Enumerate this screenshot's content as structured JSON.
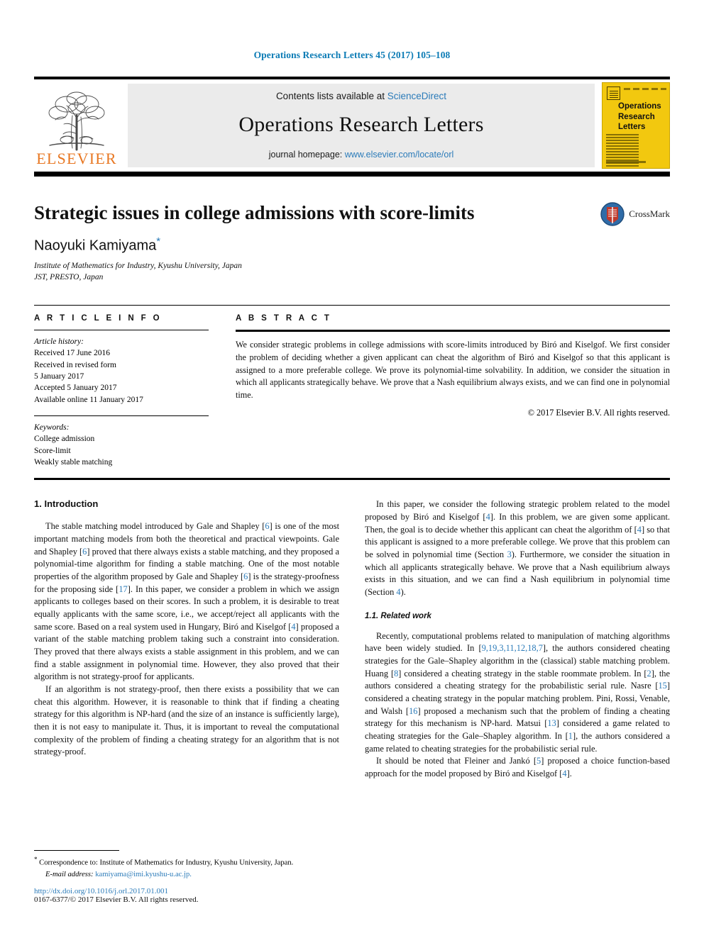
{
  "running_head": "Operations Research Letters 45 (2017) 105–108",
  "masthead": {
    "publisher_name": "ELSEVIER",
    "contents_prefix": "Contents lists available at ",
    "contents_link": "ScienceDirect",
    "journal_name": "Operations Research Letters",
    "homepage_prefix": "journal homepage: ",
    "homepage_url": "www.elsevier.com/locate/orl",
    "cover_title": "Operations Research Letters"
  },
  "article": {
    "title": "Strategic issues in college admissions with score-limits",
    "author": "Naoyuki Kamiyama",
    "author_marker": "*",
    "affiliation_1": "Institute of Mathematics for Industry, Kyushu University, Japan",
    "affiliation_2": "JST, PRESTO, Japan",
    "crossmark_label": "CrossMark"
  },
  "info": {
    "section_label": "A R T I C L E   I N F O",
    "history_heading": "Article history:",
    "history_lines": [
      "Received 17 June 2016",
      "Received in revised form",
      "5 January 2017",
      "Accepted 5 January 2017",
      "Available online 11 January 2017"
    ],
    "keywords_heading": "Keywords:",
    "keywords": [
      "College admission",
      "Score-limit",
      "Weakly stable matching"
    ]
  },
  "abstract": {
    "section_label": "A B S T R A C T",
    "text": "We consider strategic problems in college admissions with score-limits introduced by Biró and Kiselgof. We first consider the problem of deciding whether a given applicant can cheat the algorithm of Biró and Kiselgof so that this applicant is assigned to a more preferable college. We prove its polynomial-time solvability. In addition, we consider the situation in which all applicants strategically behave. We prove that a Nash equilibrium always exists, and we can find one in polynomial time.",
    "copyright": "© 2017 Elsevier B.V. All rights reserved."
  },
  "body": {
    "section_1_heading": "1.  Introduction",
    "left_paragraphs": [
      "The stable matching model introduced by Gale and Shapley [6] is one of the most important matching models from both the theoretical and practical viewpoints. Gale and Shapley [6] proved that there always exists a stable matching, and they proposed a polynomial-time algorithm for finding a stable matching. One of the most notable properties of the algorithm proposed by Gale and Shapley [6] is the strategy-proofness for the proposing side [17]. In this paper, we consider a problem in which we assign applicants to colleges based on their scores. In such a problem, it is desirable to treat equally applicants with the same score, i.e., we accept/reject all applicants with the same score. Based on a real system used in Hungary, Biró and Kiselgof [4] proposed a variant of the stable matching problem taking such a constraint into consideration. They proved that there always exists a stable assignment in this problem, and we can find a stable assignment in polynomial time. However, they also proved that their algorithm is not strategy-proof for applicants.",
      "If an algorithm is not strategy-proof, then there exists a possibility that we can cheat this algorithm. However, it is reasonable to think that if finding a cheating strategy for this algorithm is NP-hard (and the size of an instance is sufficiently large), then it is not easy to manipulate it. Thus, it is important to reveal the computational complexity of the problem of finding a cheating strategy for an algorithm that is not strategy-proof."
    ],
    "right_intro_paragraph": "In this paper, we consider the following strategic problem related to the model proposed by Biró and Kiselgof [4]. In this problem, we are given some applicant. Then, the goal is to decide whether this applicant can cheat the algorithm of [4] so that this applicant is assigned to a more preferable college. We prove that this problem can be solved in polynomial time (Section 3). Furthermore, we consider the situation in which all applicants strategically behave. We prove that a Nash equilibrium always exists in this situation, and we can find a Nash equilibrium in polynomial time (Section 4).",
    "subsection_1_1_heading": "1.1.  Related work",
    "right_paragraphs": [
      "Recently, computational problems related to manipulation of matching algorithms have been widely studied. In [9,19,3,11,12,18,7], the authors considered cheating strategies for the Gale–Shapley algorithm in the (classical) stable matching problem. Huang [8] considered a cheating strategy in the stable roommate problem. In [2], the authors considered a cheating strategy for the probabilistic serial rule. Nasre [15] considered a cheating strategy in the popular matching problem. Pini, Rossi, Venable, and Walsh [16] proposed a mechanism such that the problem of finding a cheating strategy for this mechanism is NP-hard. Matsui [13] considered a game related to cheating strategies for the Gale–Shapley algorithm. In [1], the authors considered a game related to cheating strategies for the probabilistic serial rule.",
      "It should be noted that Fleiner and Jankó [5] proposed a choice function-based approach for the model proposed by Biró and Kiselgof [4]."
    ]
  },
  "footnote": {
    "marker": "*",
    "correspondence": "Correspondence to: Institute of Mathematics for Industry, Kyushu University, Japan.",
    "email_label": "E-mail address:",
    "email": "kamiyama@imi.kyushu-u.ac.jp.",
    "doi": "http://dx.doi.org/10.1016/j.orl.2017.01.001",
    "issn_line": "0167-6377/© 2017 Elsevier B.V. All rights reserved."
  },
  "colors": {
    "link_blue": "#2b7bb9",
    "head_blue": "#0b7bb5",
    "elsevier_orange": "#e87722",
    "cover_yellow": "#f2c80f",
    "band_grey": "#ebebeb"
  }
}
